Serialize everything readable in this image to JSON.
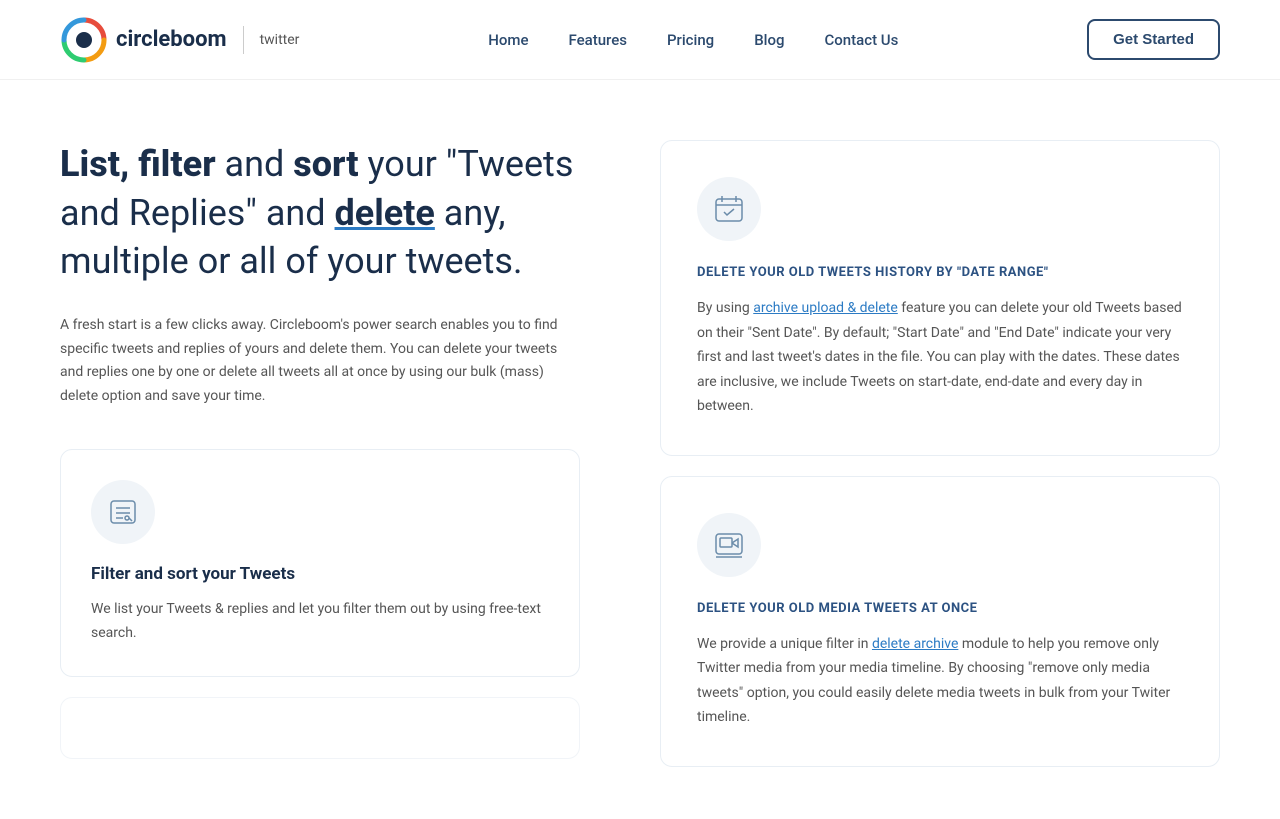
{
  "nav": {
    "logo_text": "circleboom",
    "logo_sub": "twitter",
    "links": [
      {
        "label": "Home",
        "id": "home"
      },
      {
        "label": "Features",
        "id": "features"
      },
      {
        "label": "Pricing",
        "id": "pricing"
      },
      {
        "label": "Blog",
        "id": "blog"
      },
      {
        "label": "Contact Us",
        "id": "contact"
      }
    ],
    "cta_label": "Get Started"
  },
  "hero": {
    "heading_part1": "List, filter",
    "heading_part2": "and",
    "heading_part3": "sort",
    "heading_part4": "your \"Tweets and Replies\" and",
    "heading_part5": "delete",
    "heading_part6": "any, multiple or all of your tweets.",
    "description": "A fresh start is a few clicks away. Circleboom's power search enables you to find specific tweets and replies of yours and delete them. You can delete your tweets and replies one by one or delete all tweets all at once by using our bulk (mass) delete option and save your time."
  },
  "feature_card_left": {
    "title": "Filter and sort your Tweets",
    "description": "We list your Tweets & replies and let you filter them out by using free-text search."
  },
  "right_card_1": {
    "title": "DELETE YOUR OLD TWEETS HISTORY BY \"DATE RANGE\"",
    "desc_before": "By using ",
    "link_text": "archive upload & delete",
    "desc_after": " feature you can delete your old Tweets based on their \"Sent Date\". By default; \"Start Date\" and \"End Date\" indicate your very first and last tweet's dates in the file. You can play with the dates. These dates are inclusive, we include Tweets on start-date, end-date and every day in between."
  },
  "right_card_2": {
    "title": "DELETE YOUR OLD MEDIA TWEETS AT ONCE",
    "desc_before": "We provide a unique filter in ",
    "link_text": "delete archive",
    "desc_after": " module to help you remove only Twitter media from your media timeline. By choosing \"remove only media tweets\" option, you could easily delete media tweets in bulk from your Twiter timeline."
  }
}
